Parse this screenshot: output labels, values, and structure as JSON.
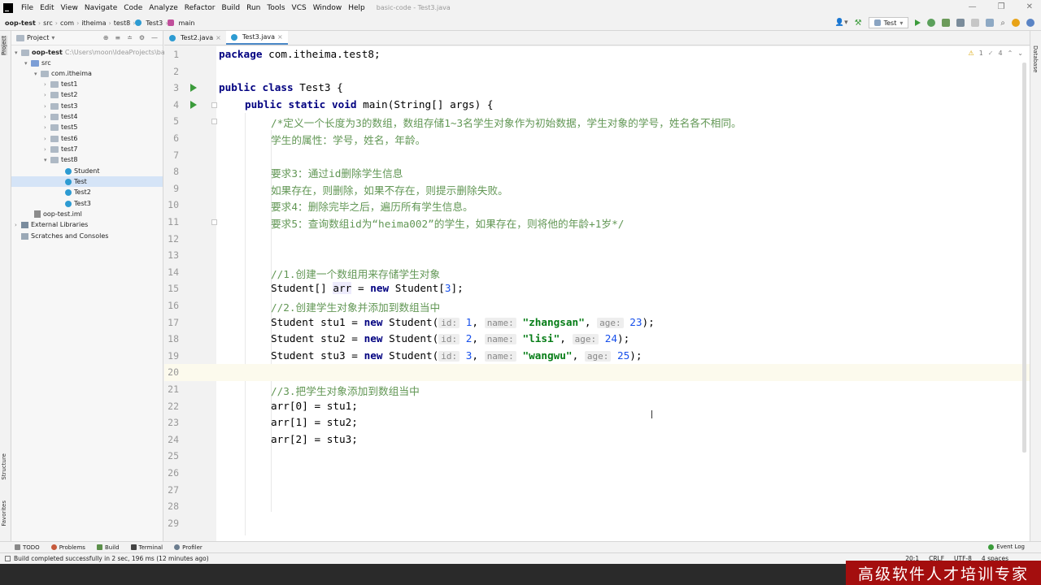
{
  "menubar": {
    "items": [
      "File",
      "Edit",
      "View",
      "Navigate",
      "Code",
      "Analyze",
      "Refactor",
      "Build",
      "Run",
      "Tools",
      "VCS",
      "Window",
      "Help"
    ],
    "window_title": "basic-code - Test3.java"
  },
  "navbar": {
    "crumbs": [
      "oop-test",
      "src",
      "com",
      "itheima",
      "test8",
      "Test3",
      "main"
    ],
    "run_config": "Test"
  },
  "left_strip": {
    "project": "Project",
    "structure": "Structure",
    "favorites": "Favorites"
  },
  "right_strip": {
    "database": "Database"
  },
  "project_panel": {
    "title": "Project",
    "root": "oop-test",
    "root_path": "C:\\Users\\moon\\IdeaProjects\\ba",
    "src": "src",
    "package": "com.itheima",
    "folders": [
      "test1",
      "test2",
      "test3",
      "test4",
      "test5",
      "test6",
      "test7",
      "test8"
    ],
    "test8_children": [
      "Student",
      "Test",
      "Test2",
      "Test3"
    ],
    "iml": "oop-test.iml",
    "external": "External Libraries",
    "scratches": "Scratches and Consoles"
  },
  "tabs": [
    {
      "label": "Test2.java"
    },
    {
      "label": "Test3.java"
    }
  ],
  "inspections": {
    "warnings": "1",
    "weak": "4"
  },
  "code": {
    "l1": "package com.itheima.test8;",
    "l3_kw": "public class",
    "l3_rest": " Test3 {",
    "l4_kw": "public static void",
    "l4_rest": " main(String[] args) {",
    "l5": "/*定义一个长度为3的数组，数组存储1~3名学生对象作为初始数据，学生对象的学号，姓名各不相同。",
    "l6": "学生的属性：学号，姓名，年龄。",
    "l8": "要求3：通过id删除学生信息",
    "l9": "如果存在，则删除，如果不存在，则提示删除失败。",
    "l10": "要求4：删除完毕之后，遍历所有学生信息。",
    "l11": "要求5：查询数组id为“heima002”的学生，如果存在，则将他的年龄+1岁*/",
    "l14": "//1.创建一个数组用来存储学生对象",
    "l15_a": "Student[] ",
    "l15_var": "arr",
    "l15_b": " = ",
    "l15_kw": "new",
    "l15_c": " Student[",
    "l15_num": "3",
    "l15_d": "];",
    "l16": "//2.创建学生对象并添加到数组当中",
    "stu_rows": [
      {
        "decl": "Student stu1 = ",
        "id": "1",
        "name": "\"zhangsan\"",
        "age": "23"
      },
      {
        "decl": "Student stu2 = ",
        "id": "2",
        "name": "\"lisi\"",
        "age": "24"
      },
      {
        "decl": "Student stu3 = ",
        "id": "3",
        "name": "\"wangwu\"",
        "age": "25"
      }
    ],
    "kw_new": "new",
    "ctor": " Student(",
    "hint_id": "id:",
    "hint_name": "name:",
    "hint_age": "age:",
    "l21": "//3.把学生对象添加到数组当中",
    "l22": "arr[0] = stu1;",
    "l23": "arr[1] = stu2;",
    "l24": "arr[2] = stu3;",
    "line_numbers": [
      "1",
      "2",
      "3",
      "4",
      "5",
      "6",
      "7",
      "8",
      "9",
      "10",
      "11",
      "12",
      "13",
      "14",
      "15",
      "16",
      "17",
      "18",
      "19",
      "20",
      "21",
      "22",
      "23",
      "24",
      "25",
      "26",
      "27",
      "28",
      "29"
    ]
  },
  "bottom_tools": [
    "TODO",
    "Problems",
    "Build",
    "Terminal",
    "Profiler"
  ],
  "event_log": "Event Log",
  "status": {
    "message": "Build completed successfully in 2 sec, 196 ms (12 minutes ago)",
    "position": "20:1",
    "line_sep": "CRLF",
    "encoding": "UTF-8",
    "indent": "4 spaces"
  },
  "banner": "高级软件人才培训专家"
}
